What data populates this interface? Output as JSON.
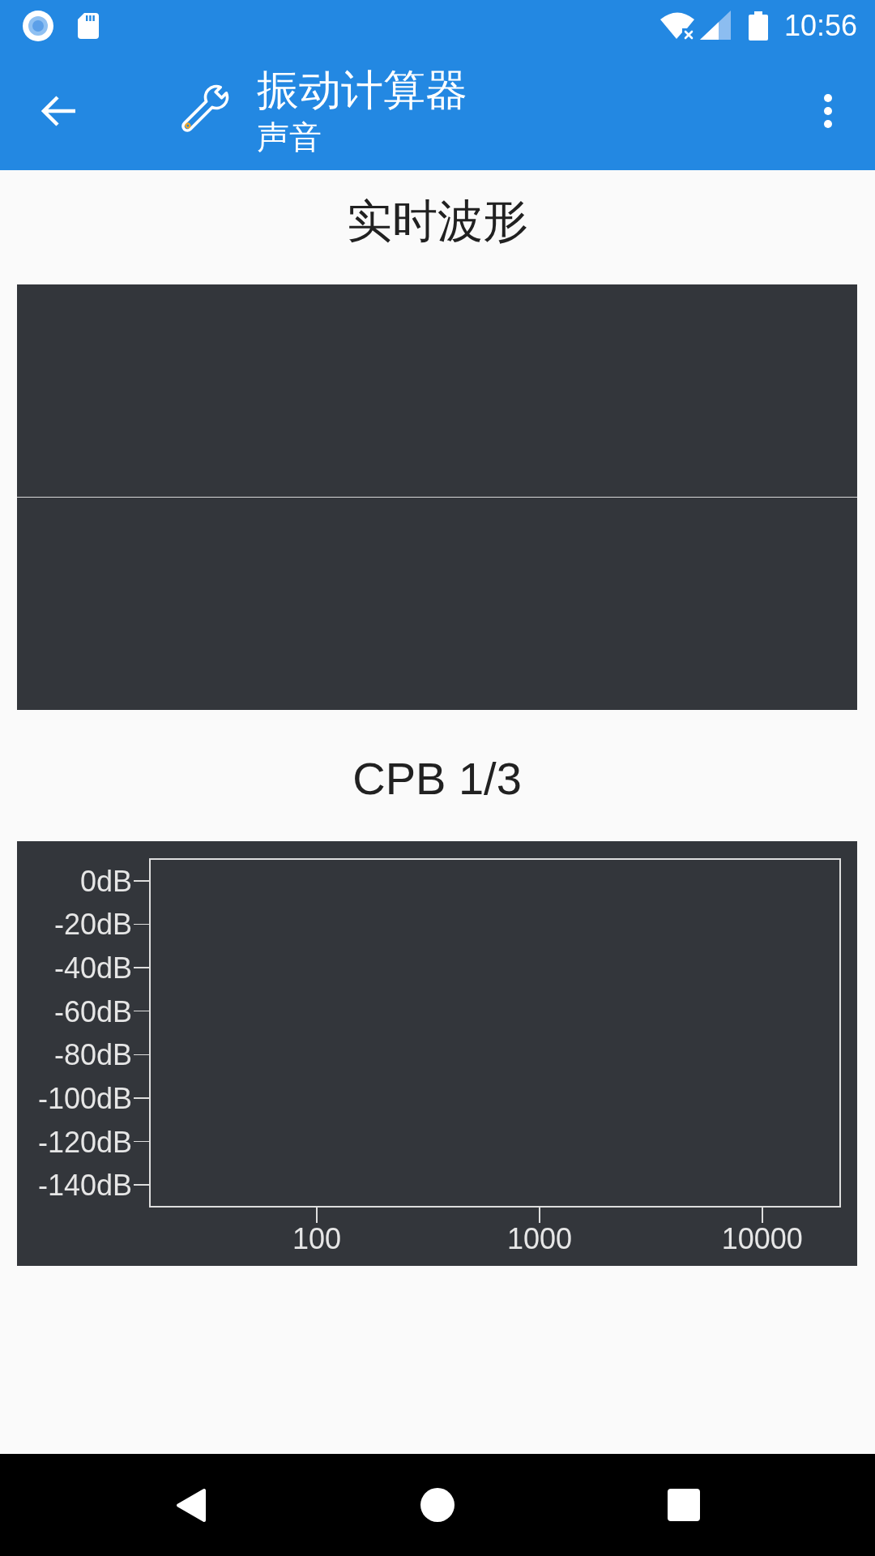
{
  "status_bar": {
    "time": "10:56"
  },
  "app_bar": {
    "title": "振动计算器",
    "subtitle": "声音"
  },
  "waveform_panel": {
    "title": "实时波形"
  },
  "cpb_panel": {
    "chart_data": {
      "type": "bar",
      "title": "CPB 1/3",
      "categories": [
        null,
        null,
        null,
        null,
        null,
        null,
        null,
        "100",
        null,
        null,
        null,
        null,
        null,
        null,
        null,
        null,
        null,
        "1000",
        null,
        null,
        null,
        null,
        null,
        null,
        null,
        null,
        null,
        "10000",
        null,
        null,
        null
      ],
      "ylim": [
        -150,
        10
      ],
      "yticks": [
        {
          "value": 0,
          "label": "0dB"
        },
        {
          "value": -20,
          "label": "-20dB"
        },
        {
          "value": -40,
          "label": "-40dB"
        },
        {
          "value": -60,
          "label": "-60dB"
        },
        {
          "value": -80,
          "label": "-80dB"
        },
        {
          "value": -100,
          "label": "-100dB"
        },
        {
          "value": -120,
          "label": "-120dB"
        },
        {
          "value": -140,
          "label": "-140dB"
        }
      ]
    }
  }
}
